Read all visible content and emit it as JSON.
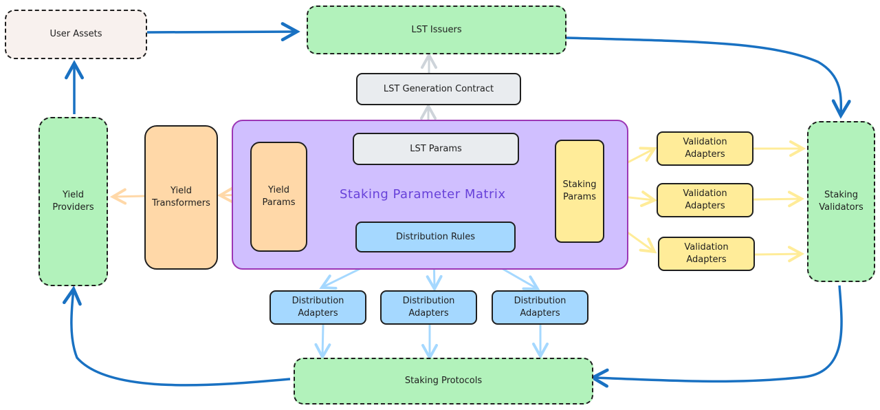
{
  "diagram": {
    "matrix": {
      "title": "Staking Parameter Matrix"
    },
    "nodes": {
      "user_assets": "User Assets",
      "lst_issuers": "LST Issuers",
      "lst_generation_contract": "LST Generation Contract",
      "lst_params": "LST Params",
      "yield_params": "Yield\nParams",
      "staking_params": "Staking\nParams",
      "distribution_rules": "Distribution Rules",
      "yield_transformers": "Yield\nTransformers",
      "yield_providers": "Yield\nProviders",
      "validation_adapters": [
        "Validation\nAdapters",
        "Validation\nAdapters",
        "Validation\nAdapters"
      ],
      "staking_validators": "Staking\nValidators",
      "distribution_adapters": [
        "Distribution\nAdapters",
        "Distribution\nAdapters",
        "Distribution\nAdapters"
      ],
      "staking_protocols": "Staking Protocols"
    },
    "colors": {
      "flow_blue": "#1971c2",
      "lst_grey": "#ced4da",
      "yield_orange": "#ffd8a8",
      "validation_yellow": "#ffec99",
      "distribution_blue": "#a5d8ff",
      "matrix_border": "#9c36b5",
      "matrix_title": "#6741d9"
    },
    "edges": [
      {
        "from": "User Assets",
        "to": "LST Issuers"
      },
      {
        "from": "LST Issuers",
        "to": "Staking Validators"
      },
      {
        "from": "Staking Validators",
        "to": "Staking Protocols"
      },
      {
        "from": "Staking Protocols",
        "to": "Yield Providers"
      },
      {
        "from": "Yield Providers",
        "to": "User Assets"
      },
      {
        "from": "LST Params",
        "to": "LST Generation Contract"
      },
      {
        "from": "LST Generation Contract",
        "to": "LST Issuers"
      },
      {
        "from": "Yield Params",
        "to": "Yield Transformers"
      },
      {
        "from": "Yield Transformers",
        "to": "Yield Providers"
      },
      {
        "from": "Staking Params",
        "to": "Validation Adapters"
      },
      {
        "from": "Validation Adapters",
        "to": "Staking Validators"
      },
      {
        "from": "Distribution Rules",
        "to": "Distribution Adapters"
      },
      {
        "from": "Distribution Adapters",
        "to": "Staking Protocols"
      }
    ]
  }
}
